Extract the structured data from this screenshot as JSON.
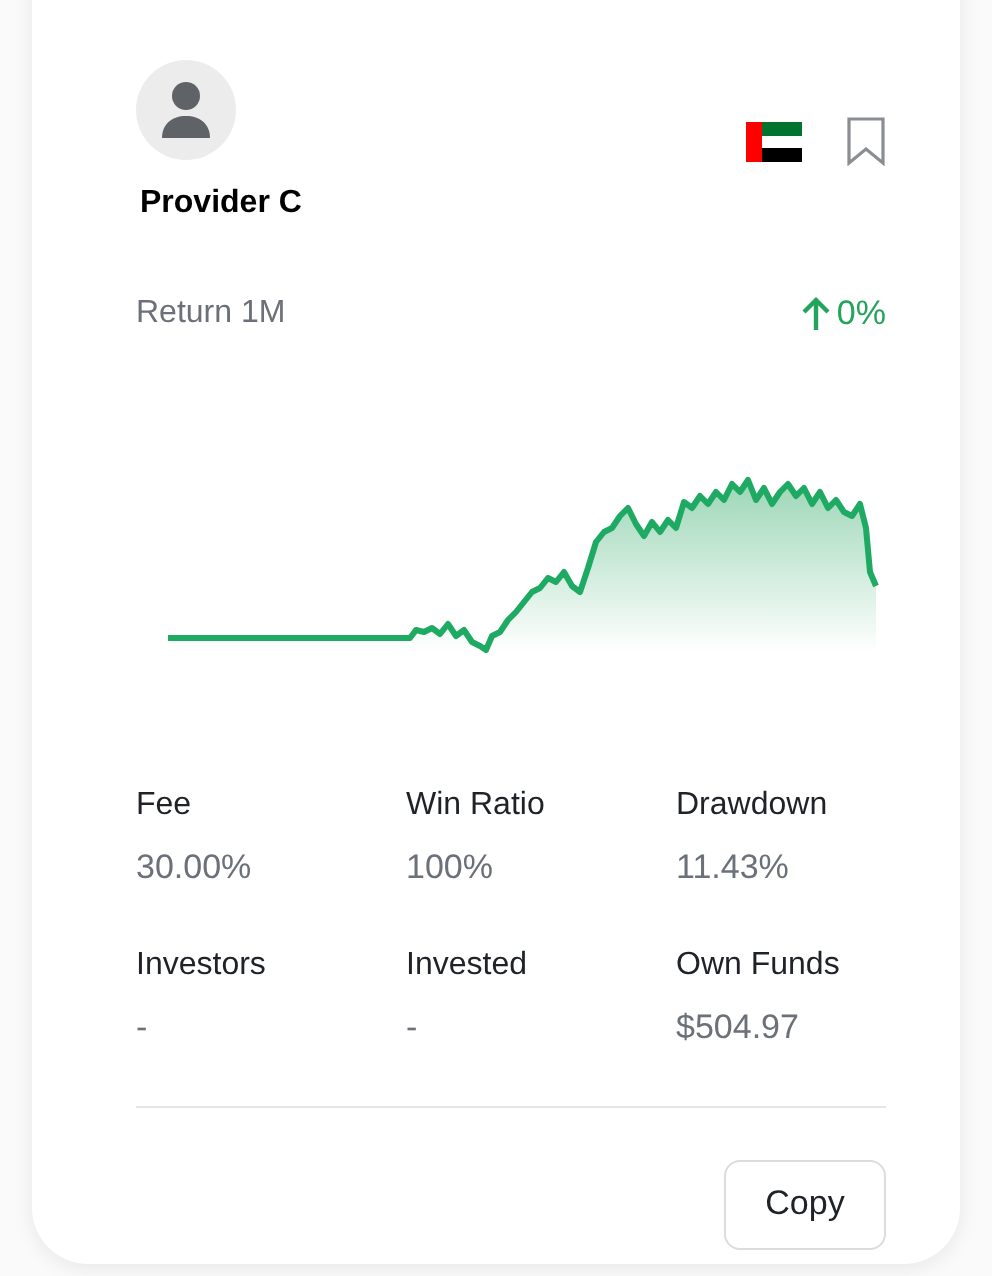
{
  "provider": {
    "name": "Provider C",
    "bookmarked": false
  },
  "return": {
    "label": "Return 1M",
    "value": "0%",
    "rising": true
  },
  "stats": [
    {
      "label": "Fee",
      "value": "30.00%"
    },
    {
      "label": "Win Ratio",
      "value": "100%"
    },
    {
      "label": "Drawdown",
      "value": "11.43%"
    },
    {
      "label": "Investors",
      "value": "-"
    },
    {
      "label": "Invested",
      "value": "-"
    },
    {
      "label": "Own Funds",
      "value": "$504.97"
    }
  ],
  "buttons": [
    "Copy"
  ]
}
